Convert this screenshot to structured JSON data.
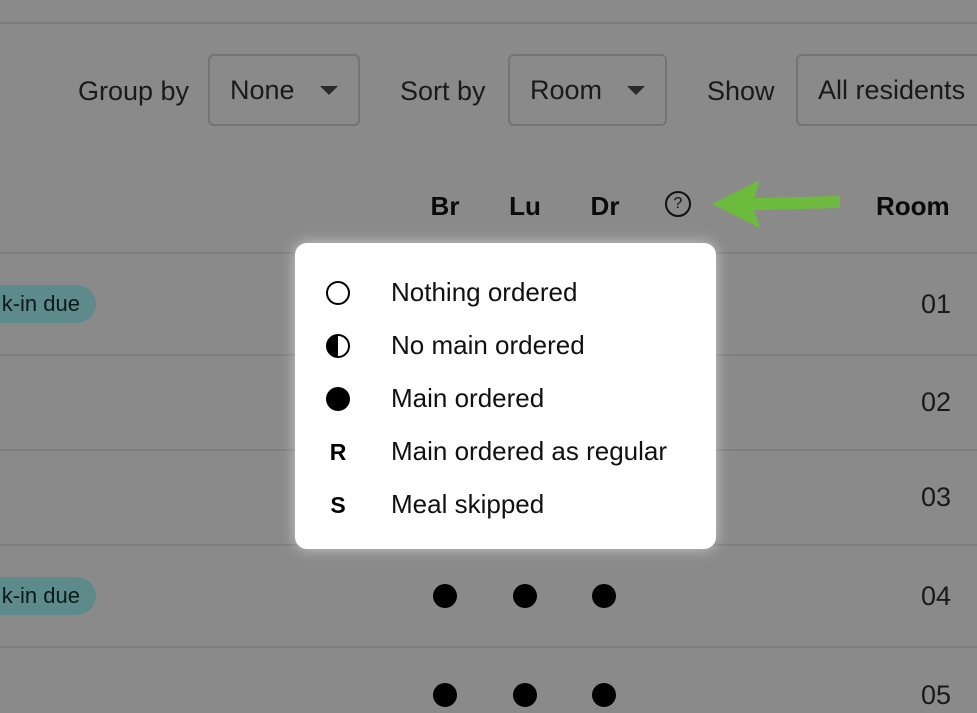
{
  "filters": {
    "group_by": {
      "label": "Group by",
      "value": "None"
    },
    "sort_by": {
      "label": "Sort by",
      "value": "Room"
    },
    "show": {
      "label": "Show",
      "value": "All residents"
    }
  },
  "columns": {
    "breakfast": "Br",
    "lunch": "Lu",
    "dinner": "Dr",
    "help": "?",
    "room": "Room"
  },
  "rows": [
    {
      "badge": "k-in due",
      "room": "01"
    },
    {
      "badge": "",
      "room": "02"
    },
    {
      "badge": "",
      "room": "03"
    },
    {
      "badge": "k-in due",
      "room": "04"
    },
    {
      "badge": "",
      "room": "05"
    }
  ],
  "legend": {
    "items": [
      {
        "symbol": "empty-circle-icon",
        "text": "Nothing ordered"
      },
      {
        "symbol": "half-circle-icon",
        "text": "No main ordered"
      },
      {
        "symbol": "filled-circle-icon",
        "text": "Main ordered"
      },
      {
        "symbol": "R",
        "text": "Main ordered as regular"
      },
      {
        "symbol": "S",
        "text": "Meal skipped"
      }
    ]
  },
  "colors": {
    "overlay_background": "#8a8a8a",
    "badge": "#5d8b8b",
    "arrow": "#6dbb3c",
    "popup": "#ffffff"
  }
}
